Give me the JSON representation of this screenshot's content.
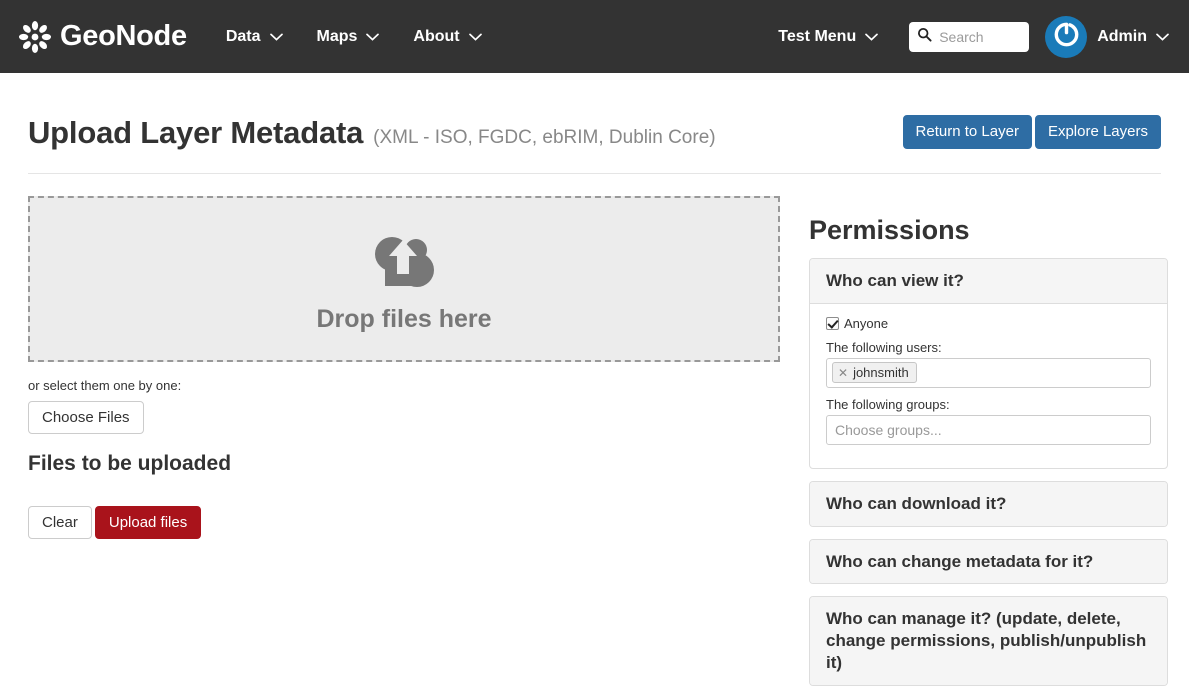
{
  "navbar": {
    "brand": {
      "text": "GeoNode",
      "logo_icon": "geonode-flower-logo"
    },
    "links": [
      {
        "label": "Data",
        "caret_icon": "chevron-down-icon"
      },
      {
        "label": "Maps",
        "caret_icon": "chevron-down-icon"
      },
      {
        "label": "About",
        "caret_icon": "chevron-down-icon"
      }
    ],
    "test_menu": {
      "label": "Test Menu",
      "caret_icon": "chevron-down-icon"
    },
    "search": {
      "placeholder": "Search",
      "value": "",
      "icon": "search-icon"
    },
    "user": {
      "label": "Admin",
      "caret_icon": "chevron-down-icon",
      "avatar_icon": "gravatar-avatar-icon"
    },
    "background_color": "#333333"
  },
  "header": {
    "title": "Upload Layer Metadata",
    "subtitle": "(XML - ISO, FGDC, ebRIM, Dublin Core)",
    "buttons": [
      {
        "label": "Return to Layer",
        "color": "#2e6da4"
      },
      {
        "label": "Explore Layers",
        "color": "#2e6da4"
      }
    ]
  },
  "upload": {
    "dropzone": {
      "label": "Drop files here",
      "icon": "cloud-upload-icon"
    },
    "select_hint": "or select them one by one:",
    "choose_files_label": "Choose Files",
    "files_heading": "Files to be uploaded",
    "clear_label": "Clear",
    "upload_label": "Upload files",
    "upload_color": "#a9131b"
  },
  "permissions": {
    "title": "Permissions",
    "panels": [
      {
        "heading": "Who can view it?",
        "open": true,
        "anyone_label": "Anyone",
        "anyone_checked": true,
        "users_label": "The following users:",
        "users_tokens": [
          {
            "name": "johnsmith",
            "remove_icon": "close-icon"
          }
        ],
        "groups_label": "The following groups:",
        "groups_placeholder": "Choose groups..."
      },
      {
        "heading": "Who can download it?",
        "open": false
      },
      {
        "heading": "Who can change metadata for it?",
        "open": false
      },
      {
        "heading": "Who can manage it? (update, delete, change permissions, publish/unpublish it)",
        "open": false
      }
    ]
  }
}
